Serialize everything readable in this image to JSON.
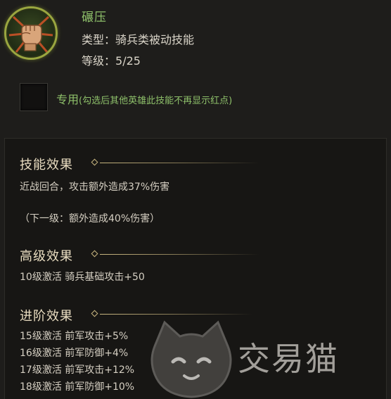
{
  "skill": {
    "icon": "fist-icon",
    "name": "碾压",
    "type_label": "类型：",
    "type_value": "骑兵类被动技能",
    "level_label": "等级：",
    "level_value": "5/25"
  },
  "exclusive": {
    "label": "专用",
    "note": "(勾选后其他英雄此技能不再显示红点)",
    "checked": false
  },
  "sections": {
    "effect": {
      "title": "技能效果",
      "lines": [
        "近战回合，攻击额外造成37%伤害",
        "（下一级：额外造成40%伤害）"
      ]
    },
    "advanced": {
      "title": "高级效果",
      "lines": [
        "10级激活 骑兵基础攻击+50"
      ]
    },
    "progression": {
      "title": "进阶效果",
      "lines": [
        "15级激活 前军攻击+5%",
        "16级激活 前军防御+4%",
        "17级激活 前军攻击+12%",
        "18级激活 前军防御+10%"
      ]
    }
  },
  "watermark": {
    "text": "交易猫",
    "icon": "cat-logo-icon"
  },
  "colors": {
    "background": "#1e1d1b",
    "panel": "#171614",
    "accent_green": "#8ec06a",
    "title_gold": "#e8dcc0",
    "divider_gold": "#c8b680",
    "icon_ring": "#9aa640"
  }
}
